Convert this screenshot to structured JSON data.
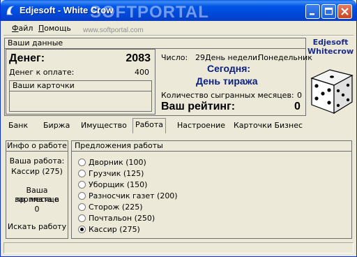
{
  "window": {
    "title": "Edjesoft - White Crow",
    "watermark": "SOFTPORTAL",
    "watermark_url": "www.softportal.com",
    "icons": [
      "app-icon",
      "minimize-icon",
      "maximize-icon",
      "close-icon"
    ]
  },
  "menu": {
    "items": [
      {
        "first": "Ф",
        "rest": "айл"
      },
      {
        "first": "П",
        "rest": "омощь"
      }
    ]
  },
  "your_data": {
    "title": "Ваши данные",
    "money_label": "Денег:",
    "money_value": "2083",
    "due_label": "Денег к оплате:",
    "due_value": "400",
    "cards_title": "Ваши карточки",
    "date_label": "Число:",
    "date_value": "29",
    "weekday_label": "День недели:",
    "weekday_value": "Понедельник",
    "today_line1": "Сегодня:",
    "today_line2": "День тиража",
    "months_label": "Количество сыгранных месяцев:",
    "months_value": "0",
    "rating_label": "Ваш рейтинг:",
    "rating_value": "0"
  },
  "brand": {
    "line1": "Edjesoft",
    "line2": "Whitecrow",
    "dice_icon": "dice-icon"
  },
  "tabs": [
    {
      "label": "Банк",
      "active": false
    },
    {
      "label": "Биржа",
      "active": false
    },
    {
      "label": "Имущество",
      "active": false
    },
    {
      "label": "Работа",
      "active": true
    },
    {
      "label": "Настроение",
      "active": false
    },
    {
      "label": "Карточки Бизнес",
      "active": false
    }
  ],
  "job_info": {
    "title": "Инфо о работе",
    "your_job_label": "Ваша работа:",
    "your_job_value": "Кассир (275)",
    "salary_line1": "Ваша зарплата в",
    "salary_line2": "пр. месяце",
    "salary_value": "0",
    "search_label": "Искать работу"
  },
  "offers": {
    "title": "Предложения работы",
    "items": [
      {
        "label": "Дворник (100)",
        "checked": false
      },
      {
        "label": "Грузчик (125)",
        "checked": false
      },
      {
        "label": "Уборщик (150)",
        "checked": false
      },
      {
        "label": "Разносчик газет (200)",
        "checked": false
      },
      {
        "label": "Сторож (225)",
        "checked": false
      },
      {
        "label": "Почтальон (250)",
        "checked": false
      },
      {
        "label": "Кассир (275)",
        "checked": true
      }
    ]
  },
  "status": {
    "text": ""
  }
}
